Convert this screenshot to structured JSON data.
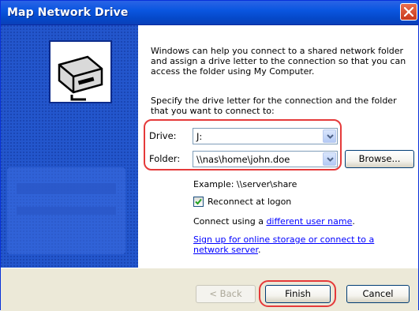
{
  "window": {
    "title": "Map Network Drive"
  },
  "intro": {
    "text": "Windows can help you connect to a shared network folder and assign a drive letter to the connection so that you can access the folder using My Computer."
  },
  "instructions": {
    "text": "Specify the drive letter for the connection and the folder that you want to connect to:"
  },
  "drive": {
    "label": "Drive:",
    "value": "J:"
  },
  "folder": {
    "label": "Folder:",
    "value": "\\\\nas\\home\\john.doe",
    "browse_label": "Browse..."
  },
  "example": {
    "text": "Example: \\\\server\\share"
  },
  "reconnect": {
    "label": "Reconnect at logon",
    "checked": true
  },
  "connect_using": {
    "prefix": "Connect using a ",
    "link": "different user name",
    "suffix": "."
  },
  "signup": {
    "link_line1": "Sign up for online storage or connect to a",
    "link_line2": "network server",
    "suffix": "."
  },
  "buttons": {
    "back": "< Back",
    "finish": "Finish",
    "cancel": "Cancel"
  },
  "colors": {
    "titlebar": "#0a56e0",
    "highlight": "#e53a3a",
    "link": "#0000ff",
    "dialog_bg": "#ece9d8"
  }
}
